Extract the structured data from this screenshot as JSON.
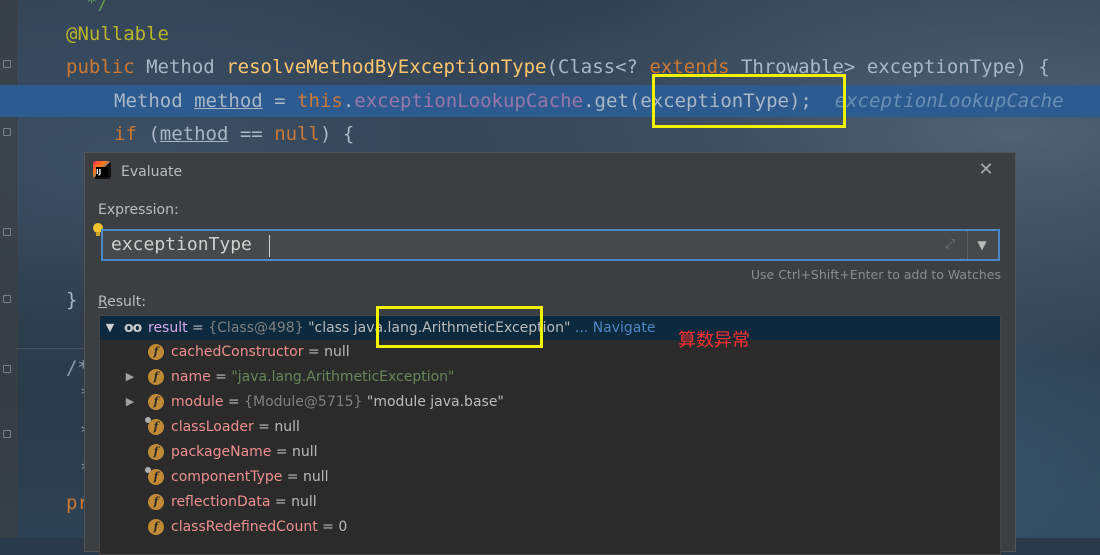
{
  "editor": {
    "comment_fragment": "*/",
    "annotation": "@Nullable",
    "signature": {
      "kw_public": "public",
      "ret_type": "Method",
      "method_name": "resolveMethodByExceptionType",
      "params_open": "(Class<? ",
      "kw_extends": "extends",
      "params_rest": " Throwable> exceptionType) {"
    },
    "line_current": {
      "type": "Method",
      "var": "method",
      "eq": " = ",
      "kw_this": "this",
      "dot": ".",
      "field": "exceptionLookupCache",
      "call": ".get(exceptionType);",
      "inline_hint": "exceptionLookupCache"
    },
    "line_if": {
      "kw_if": "if",
      "open": " (",
      "var": "method",
      "op": " == ",
      "kw_null": "null",
      "close": ") {"
    },
    "closing_brace": "}",
    "side_fragments": [
      "/*",
      "*",
      "*",
      "*",
      "pr"
    ]
  },
  "dialog": {
    "title": "Evaluate",
    "expression_label": "Expression:",
    "expression_value": "exceptionType",
    "watch_hint": "Use Ctrl+Shift+Enter to add to Watches",
    "result_label_prefix": "R",
    "result_label_rest": "esult:",
    "tree": [
      {
        "name": "result",
        "eq": " = ",
        "type": "{Class@498}",
        "value": " \"class java.lang.ArithmeticException\"",
        "link": " ... Navigate"
      },
      {
        "name": "cachedConstructor",
        "eq": " = ",
        "value": "null"
      },
      {
        "name": "name",
        "eq": " = ",
        "str": "\"java.lang.ArithmeticException\""
      },
      {
        "name": "module",
        "eq": " = ",
        "type": "{Module@5715}",
        "value": " \"module java.base\""
      },
      {
        "name": "classLoader",
        "eq": " = ",
        "value": "null"
      },
      {
        "name": "packageName",
        "eq": " = ",
        "value": "null"
      },
      {
        "name": "componentType",
        "eq": " = ",
        "value": "null"
      },
      {
        "name": "reflectionData",
        "eq": " = ",
        "value": "null"
      },
      {
        "name": "classRedefinedCount",
        "eq": " = ",
        "value": "0"
      }
    ]
  },
  "annotation_note": "算数异常",
  "colors": {
    "highlight_box": "#f2f200",
    "selection": "#2d5b8f",
    "note_red": "#ff3030"
  },
  "icons": [
    "jetbrains-app-icon",
    "close-icon",
    "lightbulb-icon",
    "expand-icon",
    "chevron-down-icon",
    "watch-glasses-icon",
    "field-icon",
    "tree-expand-icon"
  ]
}
